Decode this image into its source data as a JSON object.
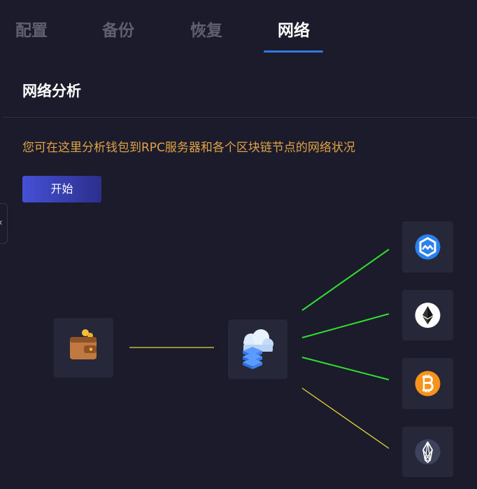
{
  "tabs": [
    {
      "label": "配置",
      "active": false
    },
    {
      "label": "备份",
      "active": false
    },
    {
      "label": "恢复",
      "active": false
    },
    {
      "label": "网络",
      "active": true
    }
  ],
  "section": {
    "title": "网络分析",
    "description": "您可在这里分析钱包到RPC服务器和各个区块链节点的网络状况",
    "start_label": "开始"
  },
  "colors": {
    "background": "#1b1b2b",
    "tab_active_underline": "#2f7ae0",
    "description_text": "#e0a346",
    "button_gradient_start": "#4550d6",
    "button_gradient_end": "#2c2f8c",
    "node_background": "#262839",
    "connection_ok": "#2fe02f",
    "connection_slow": "#e6d53a"
  },
  "diagram": {
    "wallet": {
      "icon": "wallet-icon"
    },
    "rpc_server": {
      "icon": "cloud-server-icon"
    },
    "wallet_link_status": "slow",
    "chains": [
      {
        "icon": "wanchain-icon",
        "status": "ok"
      },
      {
        "icon": "ethereum-icon",
        "status": "ok"
      },
      {
        "icon": "bitcoin-icon",
        "status": "ok"
      },
      {
        "icon": "eos-icon",
        "status": "slow"
      }
    ]
  }
}
